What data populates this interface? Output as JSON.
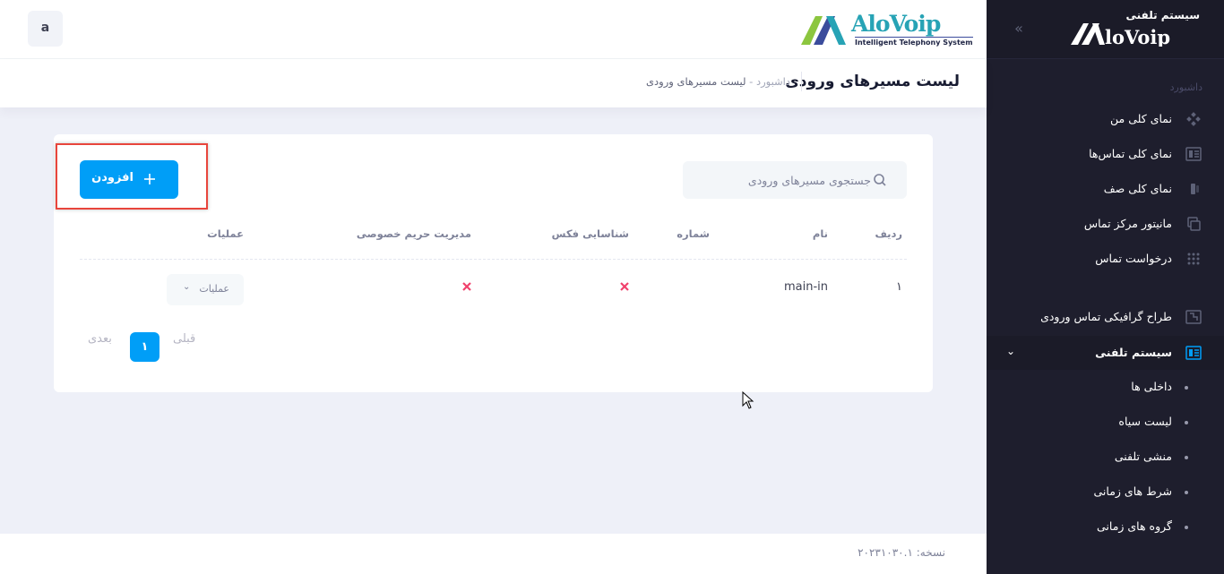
{
  "sidebar": {
    "logo_caption": "سیستم تلفنی",
    "logo_text": "AloVoip",
    "section_title": "داشبورد",
    "items": [
      {
        "label": "نمای کلی من",
        "icon": "dashboard-diamond-icon"
      },
      {
        "label": "نمای کلی تماس‌ها",
        "icon": "calls-overview-icon"
      },
      {
        "label": "نمای کلی صف",
        "icon": "queue-overview-icon"
      },
      {
        "label": "مانیتور مرکز تماس",
        "icon": "monitor-icon"
      },
      {
        "label": "درخواست تماس",
        "icon": "dialpad-icon"
      },
      {
        "label": "طراح گرافیکی تماس ورودی",
        "icon": "designer-icon"
      },
      {
        "label": "سیستم تلفنی",
        "icon": "phone-system-icon"
      }
    ],
    "sub_items": [
      {
        "label": "داخلی ها"
      },
      {
        "label": "لیست سیاه"
      },
      {
        "label": "منشی تلفنی"
      },
      {
        "label": "شرط های زمانی"
      },
      {
        "label": "گروه های زمانی"
      }
    ]
  },
  "header": {
    "avatar_letter": "a",
    "brand_name": "AloVoip",
    "brand_tagline": "Intelligent Telephony System"
  },
  "toolbar": {
    "title": "لیست مسیرهای ورودی",
    "breadcrumb_root": "داشبورد",
    "breadcrumb_sep": "-",
    "breadcrumb_current": "لیست مسیرهای ورودی"
  },
  "card": {
    "search_placeholder": "جستجوی مسیرهای ورودی",
    "add_button": "افزودن",
    "columns": {
      "index": "ردیف",
      "name": "نام",
      "number": "شماره",
      "fax": "شناسایی فکس",
      "privacy": "مدیریت حریم خصوصی",
      "actions": "عملیات"
    },
    "rows": [
      {
        "index": "۱",
        "name": "main-in",
        "number": "",
        "fax_enabled": false,
        "privacy_enabled": false,
        "actions_label": "عملیات"
      }
    ],
    "pagination": {
      "prev": "قبلی",
      "current": "۱",
      "next": "بعدی"
    }
  },
  "footer": {
    "version_label": "نسخه:",
    "version_value": "۲۰۲۳۱۰۳۰.۱"
  },
  "colors": {
    "accent": "#009ef7",
    "sidebar_bg": "#1e1e2d",
    "danger": "#f1416c",
    "highlight_border": "#e8453c"
  }
}
